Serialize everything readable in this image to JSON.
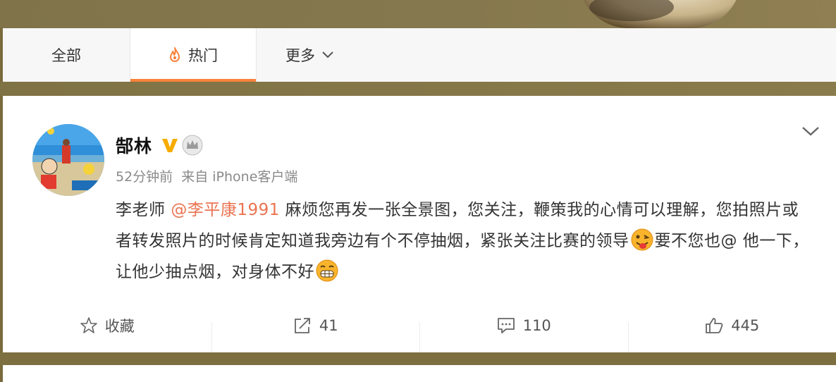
{
  "tabs": [
    {
      "label": "全部"
    },
    {
      "label": "热门",
      "icon": "fire-icon",
      "active": true
    },
    {
      "label": "更多",
      "icon": "chevron-down-icon"
    }
  ],
  "post": {
    "author": "郜林",
    "meta": {
      "time": "52分钟前",
      "source": "来自 iPhone客户端"
    },
    "text": {
      "p1": "李老师 ",
      "mention": "@李平康1991",
      "p2": " 麻烦您再发一张全景图，您关注，鞭策我的心情可以理解，您拍照片或者转发照片的时候肯定知道我旁边有个不停抽烟，紧张关注比赛的领导",
      "p3": "要不您也@ 他一下，让他少抽点烟，对身体不好"
    },
    "actions": {
      "favorite": "收藏",
      "repost": "41",
      "comment": "110",
      "like": "445"
    }
  },
  "colors": {
    "accent": "#f7823b",
    "mention": "#eb7350",
    "verified": "#f7ab00"
  }
}
